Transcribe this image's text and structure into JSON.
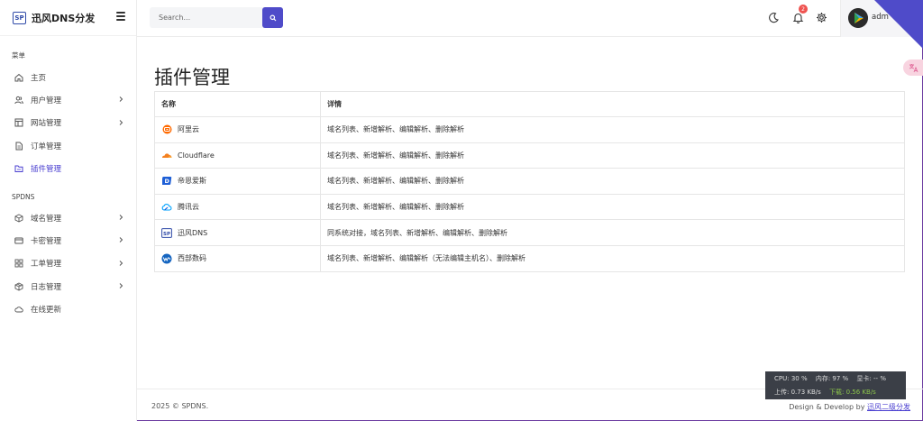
{
  "brand": {
    "logo": "SP",
    "name": "迅风DNS分发"
  },
  "sidebar": {
    "section_menu": "菜单",
    "menu_items": [
      {
        "label": "主页",
        "icon": "home-icon",
        "has_children": false
      },
      {
        "label": "用户管理",
        "icon": "users-icon",
        "has_children": true
      },
      {
        "label": "网站管理",
        "icon": "layout-icon",
        "has_children": true
      },
      {
        "label": "订单管理",
        "icon": "file-icon",
        "has_children": false
      },
      {
        "label": "插件管理",
        "icon": "folder-icon",
        "has_children": false,
        "active": true
      }
    ],
    "section_spdns": "SPDNS",
    "spdns_items": [
      {
        "label": "域名管理",
        "icon": "cube-icon",
        "has_children": true
      },
      {
        "label": "卡密管理",
        "icon": "card-icon",
        "has_children": true
      },
      {
        "label": "工单管理",
        "icon": "grid-icon",
        "has_children": true
      },
      {
        "label": "日志管理",
        "icon": "box-icon",
        "has_children": true
      },
      {
        "label": "在线更新",
        "icon": "cloud-icon",
        "has_children": false
      }
    ]
  },
  "topbar": {
    "search_placeholder": "Search...",
    "notification_count": "2",
    "username": "adm"
  },
  "main": {
    "title": "插件管理",
    "columns": [
      "名称",
      "详情"
    ],
    "rows": [
      {
        "name": "阿里云",
        "icon": "aliyun-icon",
        "detail": "域名列表、新增解析、编辑解析、删除解析"
      },
      {
        "name": "Cloudflare",
        "icon": "cloudflare-icon",
        "detail": "域名列表、新增解析、编辑解析、删除解析"
      },
      {
        "name": "帝恩爱斯",
        "icon": "dns-la-icon",
        "detail": "域名列表、新增解析、编辑解析、删除解析"
      },
      {
        "name": "腾讯云",
        "icon": "tencent-cloud-icon",
        "detail": "域名列表、新增解析、编辑解析、删除解析"
      },
      {
        "name": "迅风DNS",
        "icon": "sp-logo-icon",
        "detail": "同系统对接，域名列表、新增解析、编辑解析、删除解析"
      },
      {
        "name": "西部数码",
        "icon": "west-digital-icon",
        "detail": "域名列表、新增解析、编辑解析（无法编辑主机名）、删除解析"
      }
    ]
  },
  "footer": {
    "copyright": "2025 © SPDNS.",
    "credit_prefix": "Design & Develop by",
    "credit_link": "迅风二级分发"
  },
  "monitor": {
    "cpu": "CPU: 30 %",
    "memory": "内存: 97 %",
    "gpu": "显卡: -- %",
    "upload": "上传: 0.73 KB/s",
    "download": "下载: 0.56 KB/s"
  },
  "colors": {
    "accent": "#4f4bc9",
    "badge": "#ef5350",
    "monitor_bg": "#3b3f47"
  }
}
